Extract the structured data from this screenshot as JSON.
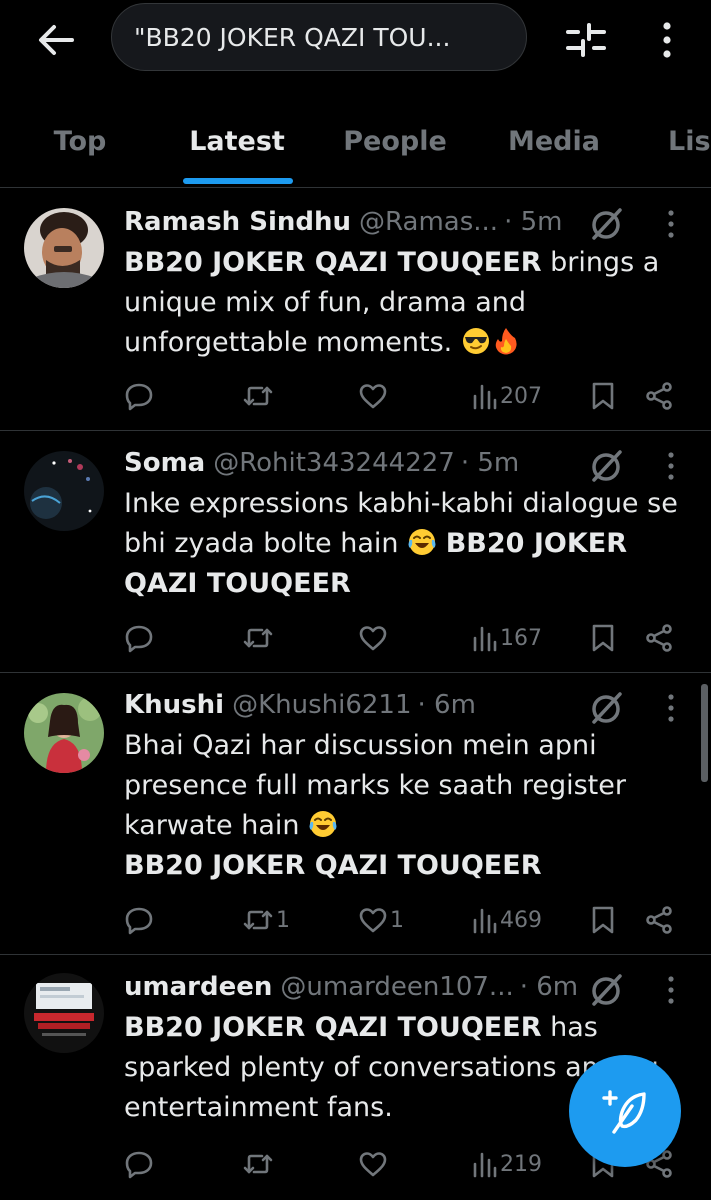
{
  "header": {
    "search_text": "\"BB20 JOKER QAZI TOU...",
    "back_icon": "arrow-left-icon",
    "filter_icon": "sliders-icon",
    "more_icon": "vertical-dots-icon"
  },
  "tabs": [
    {
      "label": "Top",
      "active": false
    },
    {
      "label": "Latest",
      "active": true
    },
    {
      "label": "People",
      "active": false
    },
    {
      "label": "Media",
      "active": false
    },
    {
      "label": "Lis",
      "active": false
    }
  ],
  "colors": {
    "background": "#000000",
    "accent": "#1d9bf0",
    "text_primary": "#e7e9ea",
    "text_secondary": "#71767b",
    "divider": "#2f3336"
  },
  "tweets": [
    {
      "name": "Ramash Sindhu",
      "handle": "@Ramas...",
      "time": "· 5m",
      "body_bold": "BB20 JOKER QAZI TOUQEER",
      "body_rest": " brings a unique mix of fun, drama and unforgettable moments.",
      "emojis": [
        "sunglasses-emoji",
        "fire-emoji"
      ],
      "replies": "",
      "reposts": "",
      "likes": "",
      "views": "207"
    },
    {
      "name": "Soma",
      "handle": "@Rohit343244227",
      "time": "· 5m",
      "body_pre": "Inke expressions kabhi-kabhi dialogue se bhi zyada bolte hain",
      "body_bold": "BB20 JOKER QAZI TOUQEER",
      "emojis": [
        "tears-of-joy-emoji"
      ],
      "replies": "",
      "reposts": "",
      "likes": "",
      "views": "167"
    },
    {
      "name": "Khushi",
      "handle": "@Khushi6211",
      "time": "· 6m",
      "body_pre": "Bhai Qazi har discussion mein apni presence full marks ke saath register karwate hain",
      "body_bold": "BB20 JOKER QAZI TOUQEER",
      "emojis": [
        "tears-of-joy-emoji"
      ],
      "replies": "",
      "reposts": "1",
      "likes": "1",
      "views": "469"
    },
    {
      "name": "umardeen",
      "handle": "@umardeen107...",
      "time": "· 6m",
      "body_bold": "BB20 JOKER QAZI TOUQEER",
      "body_rest": " has sparked plenty of conversations among entertainment fans.",
      "replies": "",
      "reposts": "",
      "likes": "",
      "views": "219"
    }
  ],
  "fab": {
    "icon": "compose-post-icon"
  }
}
